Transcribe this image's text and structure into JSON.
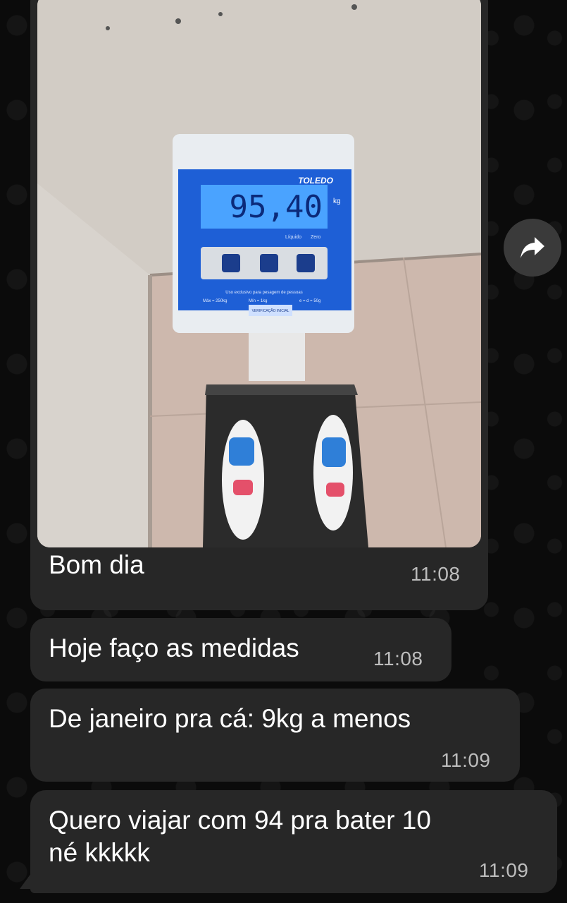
{
  "photo": {
    "scale_brand": "TOLEDO",
    "display_value": "95,40",
    "display_unit": "kg",
    "indicator_labels": [
      "Líquido",
      "Zero"
    ],
    "usage_text": "Uso exclusivo para pesagem de pessoas",
    "spec_max": "Máx = 250kg",
    "spec_min": "Mín = 1kg",
    "spec_e": "e = d = 50g",
    "sticker_text": "VERIFICAÇÃO INICIAL"
  },
  "messages": [
    {
      "text": "Bom dia",
      "time": "11:08"
    },
    {
      "text": "Hoje faço as medidas",
      "time": "11:08"
    },
    {
      "text": "De janeiro pra cá: 9kg a menos",
      "time": "11:09"
    },
    {
      "text": "Quero viajar com 94 pra bater 10\nné kkkkk",
      "time": "11:09"
    }
  ],
  "colors": {
    "bubble": "#272727",
    "background": "#0b0b0b",
    "scale_panel": "#1e5fd6",
    "lcd": "#4aa3ff"
  },
  "icons": {
    "forward": "forward-arrow-icon"
  }
}
